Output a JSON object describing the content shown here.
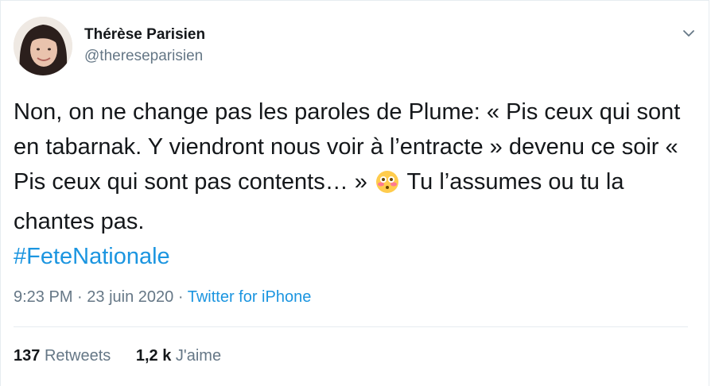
{
  "author": {
    "display_name": "Thérèse Parisien",
    "handle": "@thereseparisien"
  },
  "tweet": {
    "text_part1": "Non, on ne change pas les paroles de Plume: « Pis ceux qui sont en tabarnak. Y viendront nous voir à l’entracte » devenu ce soir « Pis ceux qui sont pas contents… »",
    "emoji": "flushed-face",
    "text_part2": "Tu l’assumes ou tu la chantes pas.",
    "hashtag": "#FeteNationale"
  },
  "meta": {
    "time": "9:23 PM",
    "separator1": "·",
    "date": "23 juin 2020",
    "separator2": "·",
    "source": "Twitter for iPhone"
  },
  "stats": {
    "retweets_count": "137",
    "retweets_label": "Retweets",
    "likes_count": "1,2 k",
    "likes_label": "J'aime"
  },
  "icons": {
    "menu": "chevron-down-icon",
    "avatar": "profile-photo"
  }
}
